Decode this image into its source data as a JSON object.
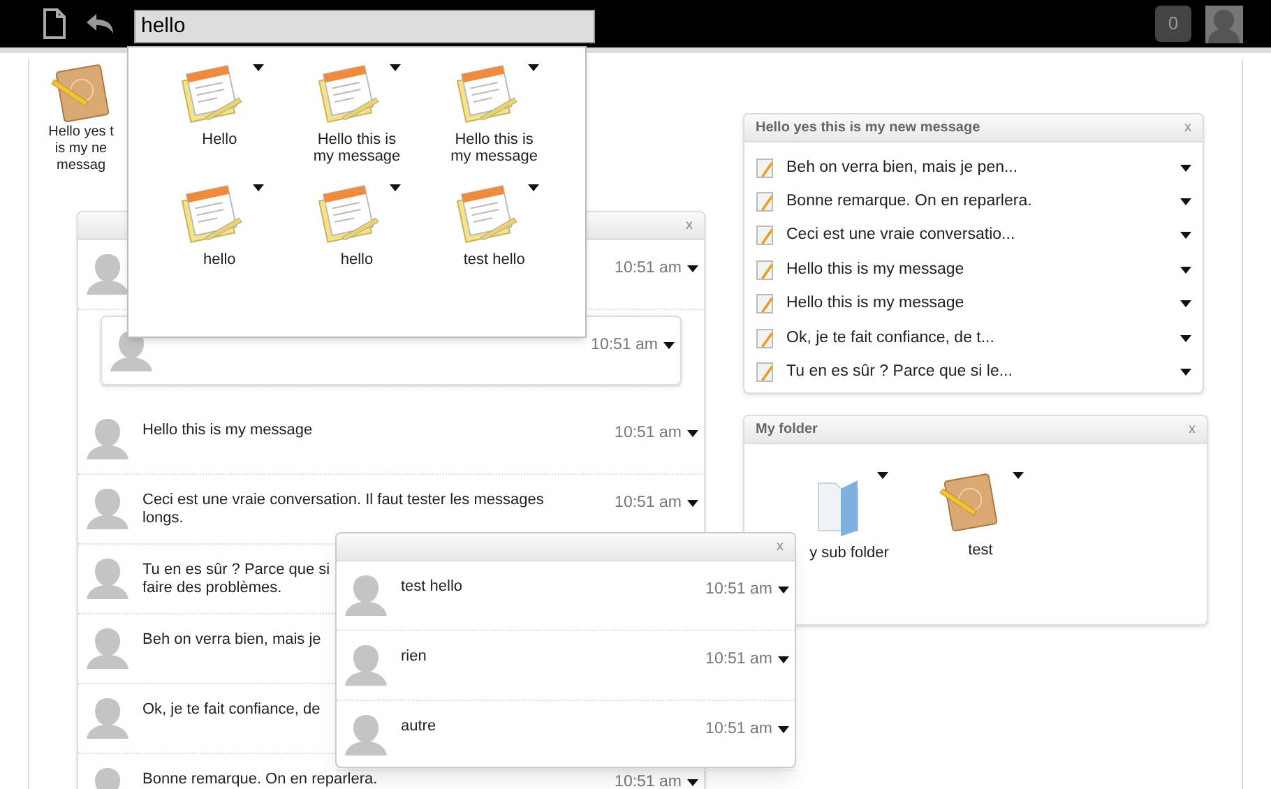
{
  "toolbar": {
    "search": {
      "value": "hello"
    },
    "notification_count": "0"
  },
  "desktop_icons": [
    {
      "label": "Hello yes t\nis my ne\nmessag"
    }
  ],
  "search_results": [
    {
      "label": "Hello"
    },
    {
      "label": "Hello this is\nmy message"
    },
    {
      "label": "Hello this is\nmy message"
    },
    {
      "label": "hello"
    },
    {
      "label": "hello"
    },
    {
      "label": "test hello"
    }
  ],
  "conversation_window": {
    "close": "x",
    "messages": [
      {
        "kind": "message",
        "time": "10:51 am"
      },
      {
        "kind": "reply",
        "time": "10:51 am"
      },
      {
        "kind": "message",
        "text": "Hello this is my message",
        "time": "10:51 am"
      },
      {
        "kind": "message",
        "text": "Ceci est une vraie conversation. Il faut tester les messages\nlongs.",
        "time": "10:51 am"
      },
      {
        "kind": "message",
        "text": "Tu en es sûr ? Parce que si\nfaire des problèmes."
      },
      {
        "kind": "message",
        "text": "Beh on verra bien, mais je"
      },
      {
        "kind": "message",
        "text": "Ok, je te fait confiance, de"
      },
      {
        "kind": "message",
        "text": "Bonne remarque. On en reparlera.",
        "time": "10:51 am"
      }
    ]
  },
  "message_list_window": {
    "title": "Hello yes this is my new message",
    "close": "x",
    "items": [
      {
        "label": "Beh on verra bien, mais je pen..."
      },
      {
        "label": "Bonne remarque. On en reparlera."
      },
      {
        "label": "Ceci est une vraie conversatio..."
      },
      {
        "label": "Hello this is my message"
      },
      {
        "label": "Hello this is my message"
      },
      {
        "label": "Ok, je te fait confiance, de t..."
      },
      {
        "label": "Tu en es sûr ? Parce que si le..."
      }
    ]
  },
  "folder_window": {
    "title": "My folder",
    "close": "x",
    "items": [
      {
        "kind": "folder",
        "label": "y sub folder"
      },
      {
        "kind": "notebook",
        "label": "test"
      }
    ]
  },
  "reply_window": {
    "close": "x",
    "messages": [
      {
        "text": "test hello",
        "time": "10:51 am"
      },
      {
        "text": "rien",
        "time": "10:51 am"
      },
      {
        "text": "autre",
        "time": "10:51 am"
      }
    ]
  }
}
